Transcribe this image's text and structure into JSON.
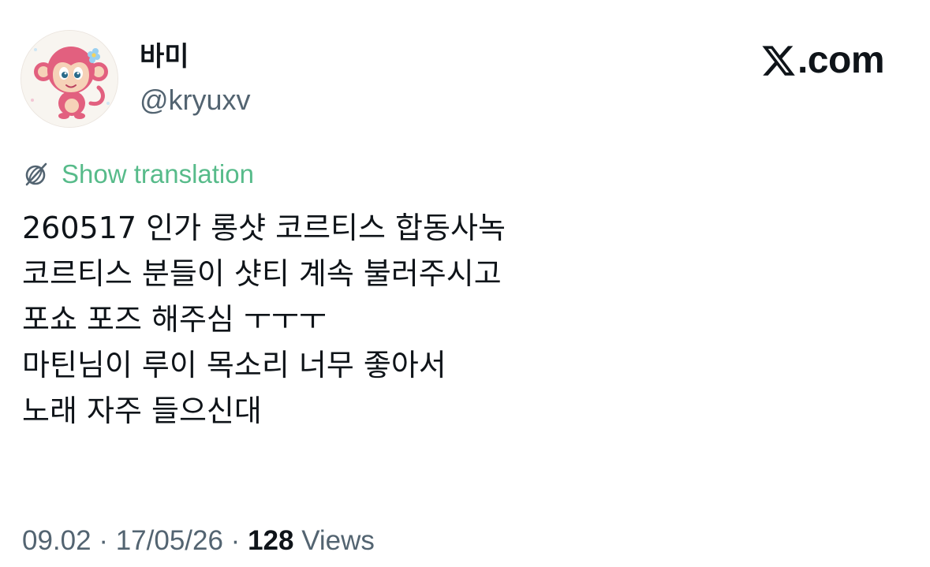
{
  "author": {
    "display_name": "바미",
    "handle": "@kryuxv"
  },
  "brand": {
    "icon": "x-logo-icon",
    "text": ".com"
  },
  "translation": {
    "icon": "globe-translate-icon",
    "label": "Show translation",
    "color": "#57bb8a"
  },
  "tweet": {
    "lines": [
      "260517 인가 롱샷 코르티스 합동사녹",
      "코르티스 분들이 샷티 계속 불러주시고",
      "포쇼 포즈 해주심 ㅜㅜㅜ",
      "마틴님이 루이 목소리 너무 좋아서",
      "노래 자주 들으신대"
    ]
  },
  "meta": {
    "time": "09.02",
    "separator": " · ",
    "date": "17/05/26",
    "views_count": "128",
    "views_label": " Views"
  },
  "colors": {
    "text_primary": "#0f1419",
    "text_secondary": "#536471",
    "translate_green": "#57bb8a"
  }
}
